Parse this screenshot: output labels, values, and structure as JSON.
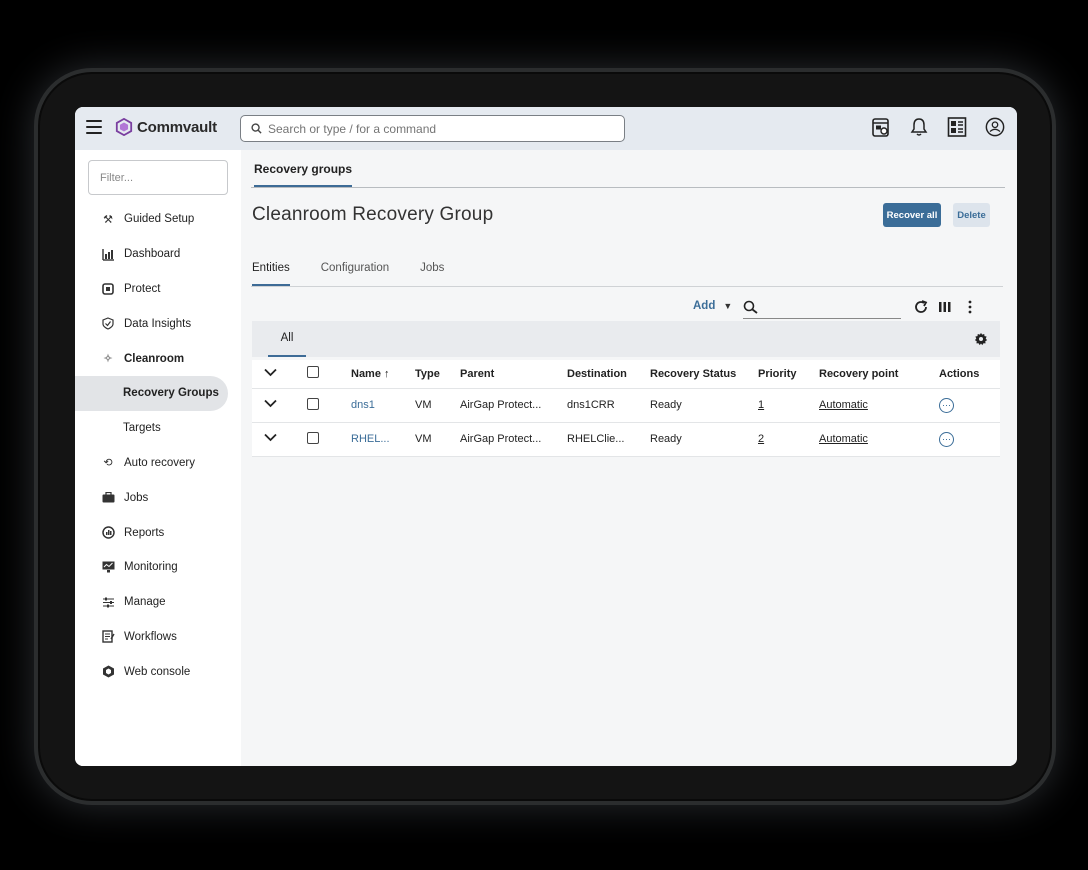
{
  "app": {
    "brand": "Commvault",
    "accent": "#3b6d98"
  },
  "search": {
    "placeholder": "Search or type / for a command"
  },
  "sidebar": {
    "filter_placeholder": "Filter...",
    "items": [
      {
        "label": "Guided Setup",
        "icon": "guided-setup-icon"
      },
      {
        "label": "Dashboard",
        "icon": "dashboard-icon"
      },
      {
        "label": "Protect",
        "icon": "protect-icon"
      },
      {
        "label": "Data Insights",
        "icon": "data-insights-icon"
      },
      {
        "label": "Cleanroom",
        "icon": "cleanroom-icon"
      },
      {
        "label": "Recovery Groups",
        "icon": ""
      },
      {
        "label": "Targets",
        "icon": ""
      },
      {
        "label": "Auto recovery",
        "icon": "auto-recovery-icon"
      },
      {
        "label": "Jobs",
        "icon": "jobs-icon"
      },
      {
        "label": "Reports",
        "icon": "reports-icon"
      },
      {
        "label": "Monitoring",
        "icon": "monitoring-icon"
      },
      {
        "label": "Manage",
        "icon": "manage-icon"
      },
      {
        "label": "Workflows",
        "icon": "workflows-icon"
      },
      {
        "label": "Web console",
        "icon": "web-console-icon"
      }
    ]
  },
  "main": {
    "breadcrumb_tab": "Recovery groups",
    "title": "Cleanroom Recovery Group",
    "recover_all": "Recover all",
    "delete": "Delete",
    "tabs": [
      "Entities",
      "Configuration",
      "Jobs"
    ],
    "toolbar": {
      "add": "Add"
    },
    "view": "All",
    "columns": [
      "Name",
      "Type",
      "Parent",
      "Destination",
      "Recovery Status",
      "Priority",
      "Recovery point",
      "Actions"
    ],
    "sort_indicator": "↑",
    "rows": [
      {
        "name": "dns1",
        "type": "VM",
        "parent": "AirGap Protect...",
        "destination": "dns1CRR",
        "status": "Ready",
        "priority": "1",
        "recovery_point": "Automatic"
      },
      {
        "name": "RHEL...",
        "type": "VM",
        "parent": "AirGap Protect...",
        "destination": "RHELClie...",
        "status": "Ready",
        "priority": "2",
        "recovery_point": "Automatic"
      }
    ]
  }
}
